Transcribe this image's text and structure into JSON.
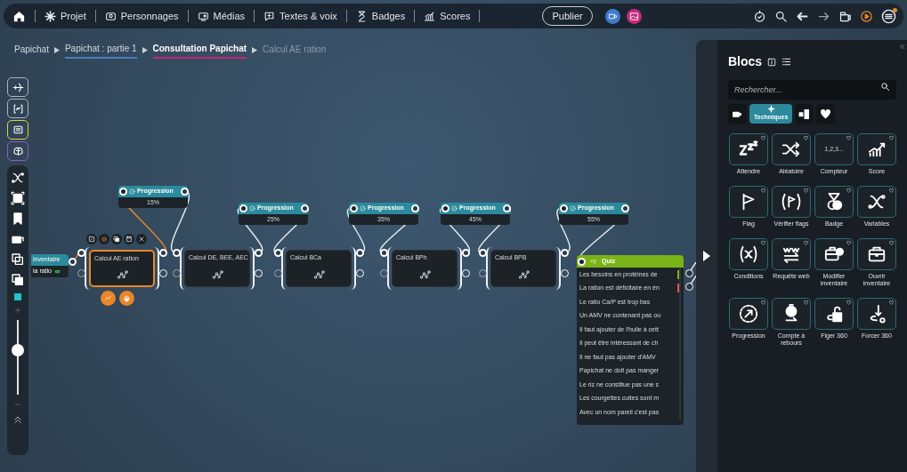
{
  "top_bar": {
    "nav": [
      {
        "label": "Projet"
      },
      {
        "label": "Personnages"
      },
      {
        "label": "Médias"
      },
      {
        "label": "Textes & voix"
      },
      {
        "label": "Badges"
      },
      {
        "label": "Scores"
      }
    ],
    "publish_button": "Publier"
  },
  "breadcrumb": [
    {
      "label": "Papichat",
      "kind": "plain"
    },
    {
      "label": "Papichat : partie 1",
      "kind": "underlined",
      "color": "#4a7fc1"
    },
    {
      "label": "Consultation Papichat",
      "kind": "current",
      "color": "#c0267a"
    },
    {
      "label": "Calcul AE ration",
      "kind": "dim"
    }
  ],
  "canvas": {
    "partial_node": {
      "lines": [
        "inventaire",
        "la ratio"
      ]
    },
    "progress_nodes": [
      {
        "title": "Progression",
        "value": "15%"
      },
      {
        "title": "Progression",
        "value": "25%"
      },
      {
        "title": "Progression",
        "value": "35%"
      },
      {
        "title": "Progression",
        "value": "45%"
      },
      {
        "title": "Progression",
        "value": "55%"
      }
    ],
    "calc_nodes": [
      {
        "title": "Calcul AE ration",
        "selected": true
      },
      {
        "title": "Calcul DE, BEE, AEC",
        "selected": false
      },
      {
        "title": "Calcul BCa",
        "selected": false
      },
      {
        "title": "Calcul BPh",
        "selected": false
      },
      {
        "title": "Calcul BPB",
        "selected": false
      }
    ],
    "quiz": {
      "title": "Quiz",
      "answers": [
        {
          "text": "Les besoins en protéines de",
          "color": "#7ab317"
        },
        {
          "text": "La ration est déficitaire en én",
          "color": "#d9534f"
        },
        {
          "text": "Le ratio Ca/P est trop bas"
        },
        {
          "text": "Un AMV ne contenant pas ou"
        },
        {
          "text": "Il faut ajouter de l'huile à cett"
        },
        {
          "text": "Il peut être intéressant de ch"
        },
        {
          "text": "Il ne faut pas ajouter d'AMV"
        },
        {
          "text": "Papichat ne doit pas manger"
        },
        {
          "text": "Le riz ne constitue pas une s"
        },
        {
          "text": "Les courgettes cuites sont m"
        },
        {
          "text": "Avec un nom pareil c'est pas"
        }
      ]
    }
  },
  "side_toolbar": {
    "zoom": {
      "level": 0.6
    }
  },
  "blocks_panel": {
    "title": "Blocs",
    "search": {
      "placeholder": "Rechercher..."
    },
    "categories": [
      {
        "selected": false
      },
      {
        "label": "Techniques",
        "selected": true
      },
      {
        "selected": false
      },
      {
        "selected": false
      }
    ],
    "blocks": [
      {
        "label": "Attendre"
      },
      {
        "label": "Aléatoire"
      },
      {
        "label": "Compteur",
        "icon_text": "1,2,3..."
      },
      {
        "label": "Score"
      },
      {
        "label": "Flag"
      },
      {
        "label": "Vérifier flags"
      },
      {
        "label": "Badge"
      },
      {
        "label": "Variables"
      },
      {
        "label": "Conditions"
      },
      {
        "label": "Requête web"
      },
      {
        "label": "Modifier inventaire"
      },
      {
        "label": "Ouvrir inventaire"
      },
      {
        "label": "Progression"
      },
      {
        "label": "Compte à rebours"
      },
      {
        "label": "Figer 360"
      },
      {
        "label": "Forcer 360"
      }
    ]
  }
}
